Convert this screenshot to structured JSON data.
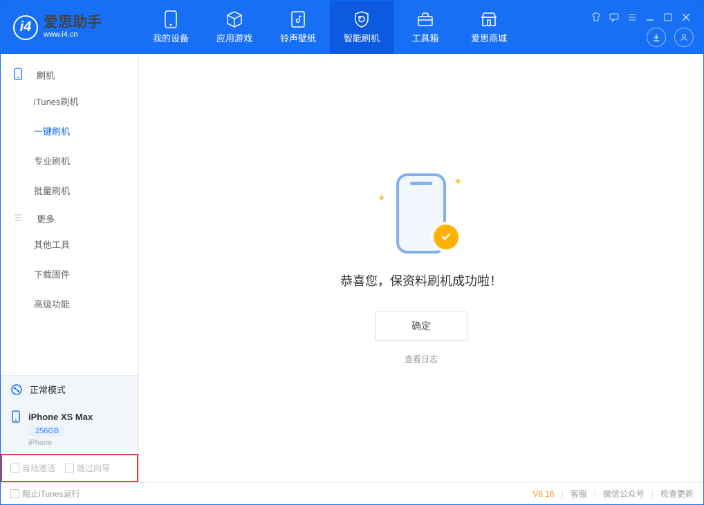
{
  "app": {
    "name": "爱思助手",
    "domain": "www.i4.cn"
  },
  "nav": {
    "items": [
      {
        "label": "我的设备"
      },
      {
        "label": "应用游戏"
      },
      {
        "label": "铃声壁纸"
      },
      {
        "label": "智能刷机"
      },
      {
        "label": "工具箱"
      },
      {
        "label": "爱思商城"
      }
    ],
    "activeIndex": 3
  },
  "sidebar": {
    "section1": {
      "title": "刷机"
    },
    "items1": [
      {
        "label": "iTunes刷机"
      },
      {
        "label": "一键刷机"
      },
      {
        "label": "专业刷机"
      },
      {
        "label": "批量刷机"
      }
    ],
    "section2": {
      "title": "更多"
    },
    "items2": [
      {
        "label": "其他工具"
      },
      {
        "label": "下载固件"
      },
      {
        "label": "高级功能"
      }
    ],
    "activeItems1Index": 1,
    "mode_label": "正常模式",
    "device": {
      "name": "iPhone XS Max",
      "capacity": "256GB",
      "type": "iPhone"
    },
    "checks": {
      "auto_activate": "自动激活",
      "skip_guide": "跳过向导"
    }
  },
  "main": {
    "success_message": "恭喜您，保资料刷机成功啦！",
    "ok_button": "确定",
    "view_log": "查看日志"
  },
  "footer": {
    "block_itunes": "阻止iTunes运行",
    "version": "V8.16",
    "support": "客服",
    "wechat": "微信公众号",
    "check_update": "检查更新"
  }
}
